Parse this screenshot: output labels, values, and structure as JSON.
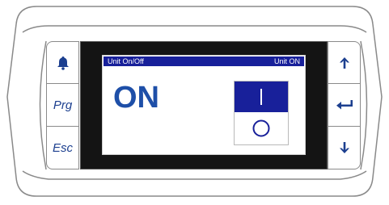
{
  "keypad": {
    "left_buttons": [
      {
        "name": "alarm",
        "icon": "bell-icon",
        "label": ""
      },
      {
        "name": "prg",
        "label": "Prg"
      },
      {
        "name": "esc",
        "label": "Esc"
      }
    ],
    "right_buttons": [
      {
        "name": "up",
        "icon": "arrow-up-icon"
      },
      {
        "name": "enter",
        "icon": "enter-arrow-icon"
      },
      {
        "name": "down",
        "icon": "arrow-down-icon"
      }
    ]
  },
  "display": {
    "title": "Unit On/Off",
    "status": "Unit ON",
    "value": "ON",
    "toggle": {
      "on_symbol": "|",
      "off_symbol": "○",
      "selected": "on"
    }
  },
  "colors": {
    "header_blue": "#18209a",
    "value_blue": "#1e4fa8",
    "button_label": "#1c3f8f",
    "screen_frame": "#141414"
  }
}
